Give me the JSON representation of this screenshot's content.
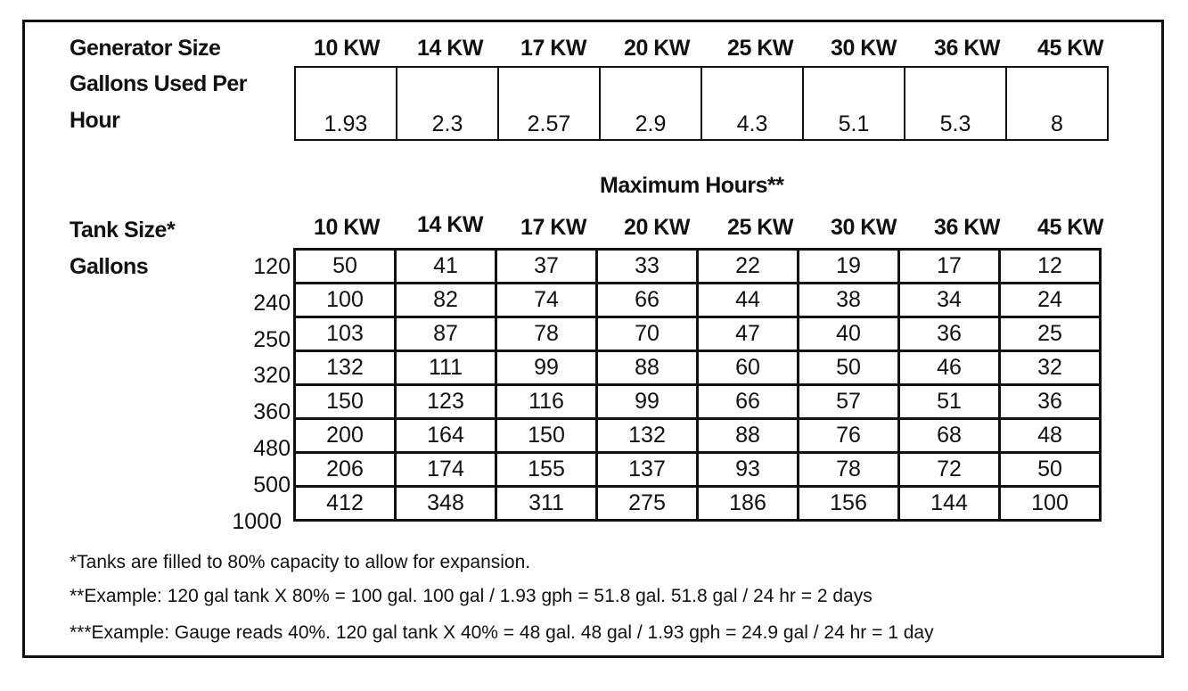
{
  "top_section": {
    "generator_size_label": "Generator Size",
    "gph_label_line1": "Gallons Used Per",
    "gph_label_line2": "Hour",
    "columns": [
      "10 KW",
      "14 KW",
      "17 KW",
      "20 KW",
      "25 KW",
      "30 KW",
      "36 KW",
      "45 KW"
    ],
    "gallons_per_hour": [
      "1.93",
      "2.3",
      "2.57",
      "2.9",
      "4.3",
      "5.1",
      "5.3",
      "8"
    ]
  },
  "hours_section": {
    "title": "Maximum Hours**",
    "tank_size_label": "Tank Size*",
    "gallons_label": "Gallons",
    "columns": [
      "10 KW",
      "14 KW",
      "17 KW",
      "20 KW",
      "25 KW",
      "30 KW",
      "36 KW",
      "45 KW"
    ],
    "rows": [
      {
        "tank": "120",
        "values": [
          "50",
          "41",
          "37",
          "33",
          "22",
          "19",
          "17",
          "12"
        ]
      },
      {
        "tank": "240",
        "values": [
          "100",
          "82",
          "74",
          "66",
          "44",
          "38",
          "34",
          "24"
        ]
      },
      {
        "tank": "250",
        "values": [
          "103",
          "87",
          "78",
          "70",
          "47",
          "40",
          "36",
          "25"
        ]
      },
      {
        "tank": "320",
        "values": [
          "132",
          "111",
          "99",
          "88",
          "60",
          "50",
          "46",
          "32"
        ]
      },
      {
        "tank": "360",
        "values": [
          "150",
          "123",
          "116",
          "99",
          "66",
          "57",
          "51",
          "36"
        ]
      },
      {
        "tank": "480",
        "values": [
          "200",
          "164",
          "150",
          "132",
          "88",
          "76",
          "68",
          "48"
        ]
      },
      {
        "tank": "500",
        "values": [
          "206",
          "174",
          "155",
          "137",
          "93",
          "78",
          "72",
          "50"
        ]
      },
      {
        "tank": "1000",
        "values": [
          "412",
          "348",
          "311",
          "275",
          "186",
          "156",
          "144",
          "100"
        ]
      }
    ]
  },
  "notes": [
    "*Tanks are filled to 80% capacity to allow for expansion.",
    "**Example: 120 gal tank X 80% = 100 gal. 100 gal / 1.93 gph = 51.8 gal. 51.8 gal / 24 hr = 2 days",
    "***Example: Gauge reads 40%. 120 gal tank X 40% = 48 gal. 48 gal / 1.93 gph = 24.9 gal / 24 hr = 1 day"
  ]
}
